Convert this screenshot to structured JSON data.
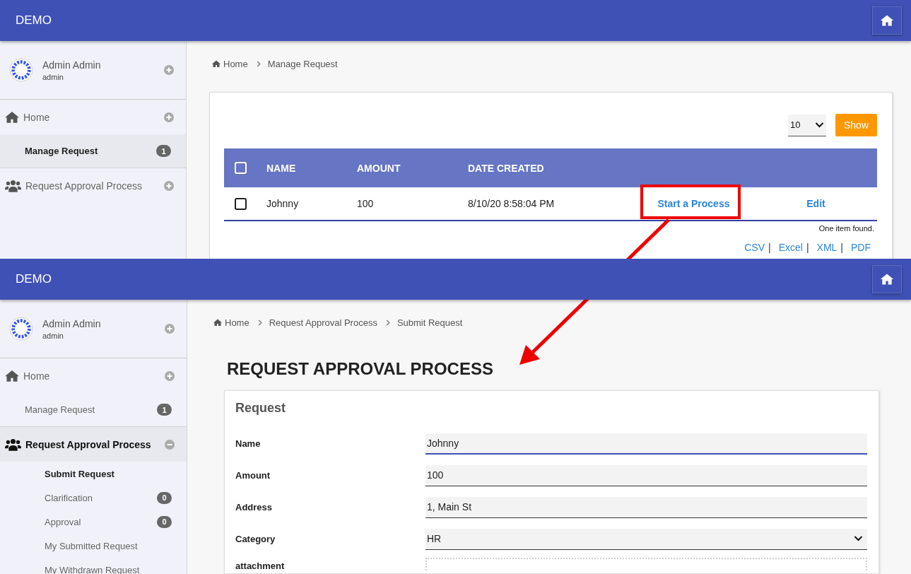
{
  "screens": [
    {
      "kind": "list",
      "app_title": "DEMO",
      "user": {
        "name": "Admin Admin",
        "login": "admin"
      },
      "nav": [
        {
          "label": "Home",
          "expanded": false,
          "selected": false,
          "children": [
            {
              "label": "Manage Request",
              "badge": "1",
              "selected": true
            }
          ]
        },
        {
          "label": "Request Approval Process",
          "expanded": false,
          "selected": false
        }
      ],
      "breadcrumb": [
        "Home",
        "Manage Request"
      ],
      "page_size": "10",
      "show_button": "Show",
      "table": {
        "header_checked": false,
        "columns": [
          "NAME",
          "AMOUNT",
          "DATE CREATED"
        ],
        "rows": [
          {
            "checked": false,
            "cells": [
              "Johnny",
              "100",
              "8/10/20 8:58:04 PM"
            ],
            "actions": [
              "Start a Process",
              "Edit"
            ]
          }
        ]
      },
      "result_count": "One item found.",
      "exports": [
        {
          "label": "CSV",
          "separator": "|"
        },
        {
          "label": "Excel",
          "separator": "|"
        },
        {
          "label": "XML",
          "separator": "|"
        },
        {
          "label": "PDF"
        }
      ]
    },
    {
      "kind": "form",
      "app_title": "DEMO",
      "user": {
        "name": "Admin Admin",
        "login": "admin"
      },
      "nav": [
        {
          "label": "Home",
          "expanded": false,
          "selected": false,
          "children": [
            {
              "label": "Manage Request",
              "badge": "1",
              "selected": false
            }
          ]
        },
        {
          "label": "Request Approval Process",
          "expanded": true,
          "selected": true,
          "children": [
            {
              "label": "Submit Request",
              "selected": true
            },
            {
              "label": "Clarification",
              "badge": "0",
              "selected": false
            },
            {
              "label": "Approval",
              "badge": "0",
              "selected": false
            },
            {
              "label": "My Submitted Request",
              "selected": false
            },
            {
              "label": "My Withdrawn Request",
              "selected": false
            }
          ]
        }
      ],
      "breadcrumb": [
        "Home",
        "Request Approval Process",
        "Submit Request"
      ],
      "heading": "REQUEST APPROVAL PROCESS",
      "card_title": "Request",
      "fields": [
        {
          "label": "Name",
          "kind": "text",
          "value": "Johnny",
          "focused": true
        },
        {
          "label": "Amount",
          "kind": "text",
          "value": "100",
          "focused": false
        },
        {
          "label": "Address",
          "kind": "text",
          "value": "1, Main St",
          "focused": false
        },
        {
          "label": "Category",
          "kind": "select",
          "value": "HR",
          "focused": false
        },
        {
          "label": "attachment",
          "kind": "file"
        }
      ]
    }
  ]
}
